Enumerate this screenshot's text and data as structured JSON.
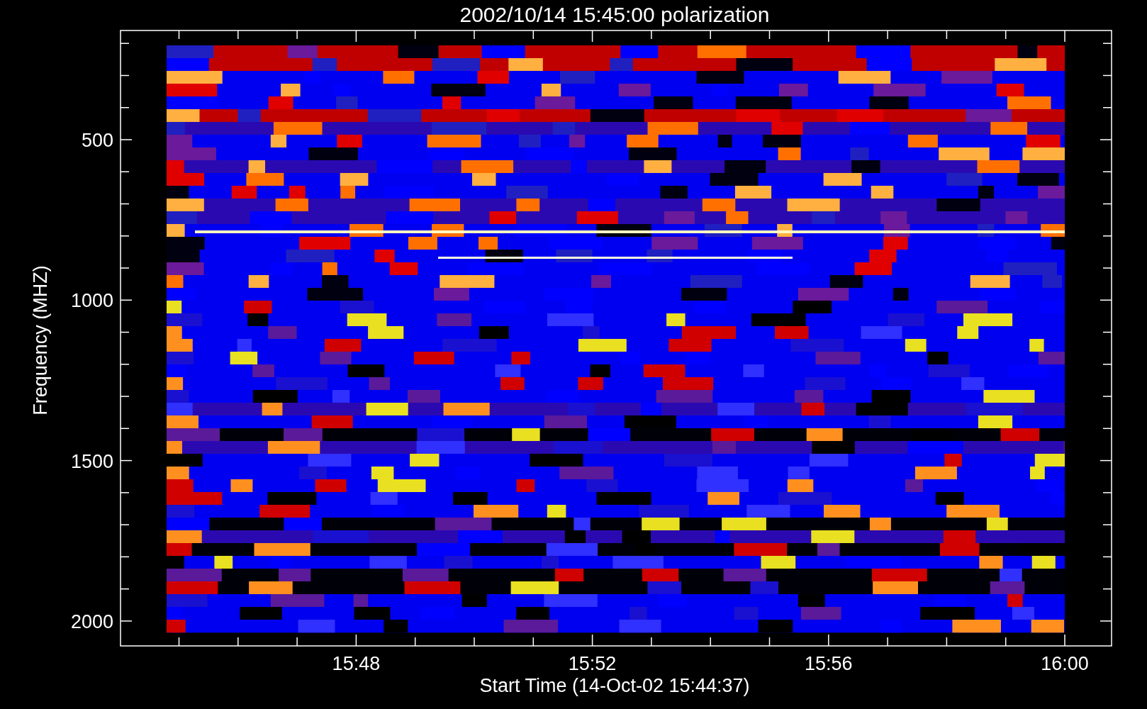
{
  "title": "2002/10/14 15:45:00 polarization",
  "spectrogram": {
    "xlabel": "Start Time (14-Oct-02 15:44:37)",
    "ylabel": "Frequency (MHZ)",
    "xticks": [
      "15:48",
      "15:52",
      "15:56",
      "16:00"
    ],
    "yticks": [
      "500",
      "1000",
      "1500",
      "2000"
    ]
  }
}
